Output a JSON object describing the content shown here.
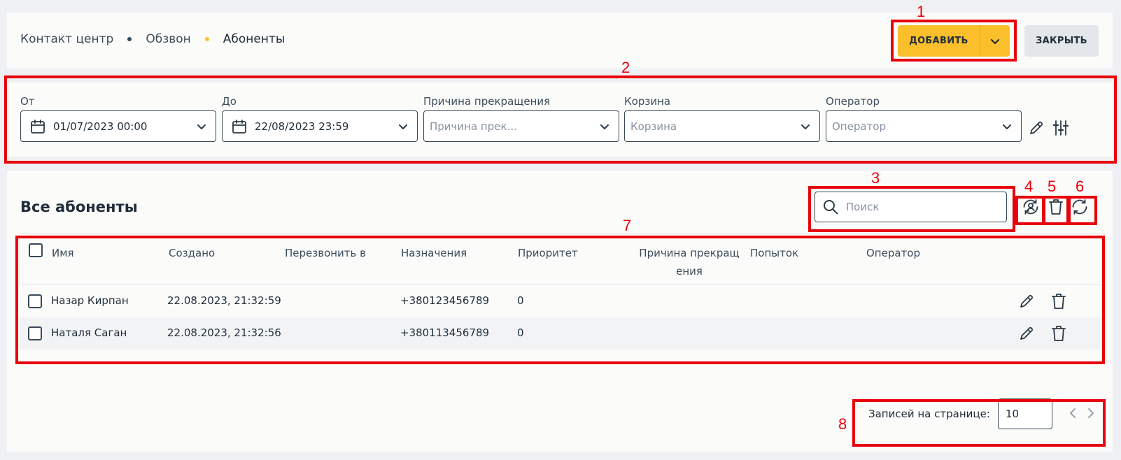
{
  "breadcrumb": {
    "items": [
      "Контакт центр",
      "Обзвон",
      "Абоненты"
    ],
    "separator_colors": [
      "#2f4a60",
      "#fbbf2b"
    ]
  },
  "header": {
    "add_label": "ДОБАВИТЬ",
    "close_label": "ЗАКРЫТЬ",
    "accent_color": "#fbbf2b"
  },
  "filters": {
    "from": {
      "label": "От",
      "value": "01/07/2023 00:00"
    },
    "to": {
      "label": "До",
      "value": "22/08/2023 23:59"
    },
    "reason": {
      "label": "Причина прекращения",
      "placeholder": "Причина прек..."
    },
    "basket": {
      "label": "Корзина",
      "placeholder": "Корзина"
    },
    "operator": {
      "label": "Оператор",
      "placeholder": "Оператор"
    },
    "icons": [
      "pencil-icon",
      "sliders-icon"
    ]
  },
  "main": {
    "title": "Все абоненты",
    "search_placeholder": "Поиск",
    "action_icons": [
      "user-refresh-icon",
      "trash-icon",
      "refresh-icon"
    ]
  },
  "table": {
    "columns": [
      "Имя",
      "Создано",
      "Перезвонить в",
      "Назначения",
      "Приоритет",
      "Причина прекращ ения",
      "Попыток",
      "Оператор"
    ],
    "reason_col_line1": "Причина прекращ",
    "reason_col_line2": "ения",
    "rows": [
      {
        "name": "Назар Кирпан",
        "created": "22.08.2023, 21:32:59",
        "callback": "",
        "destination": "+380123456789",
        "priority": "0",
        "reason": "",
        "attempts": "",
        "operator": ""
      },
      {
        "name": "Наталя Саган",
        "created": "22.08.2023, 21:32:56",
        "callback": "",
        "destination": "+380113456789",
        "priority": "0",
        "reason": "",
        "attempts": "",
        "operator": ""
      }
    ]
  },
  "pagination": {
    "label": "Записей на странице:",
    "page_size": "10"
  },
  "annotations": [
    "1",
    "2",
    "3",
    "4",
    "5",
    "6",
    "7",
    "8"
  ],
  "annotation_color": "#e8000b"
}
